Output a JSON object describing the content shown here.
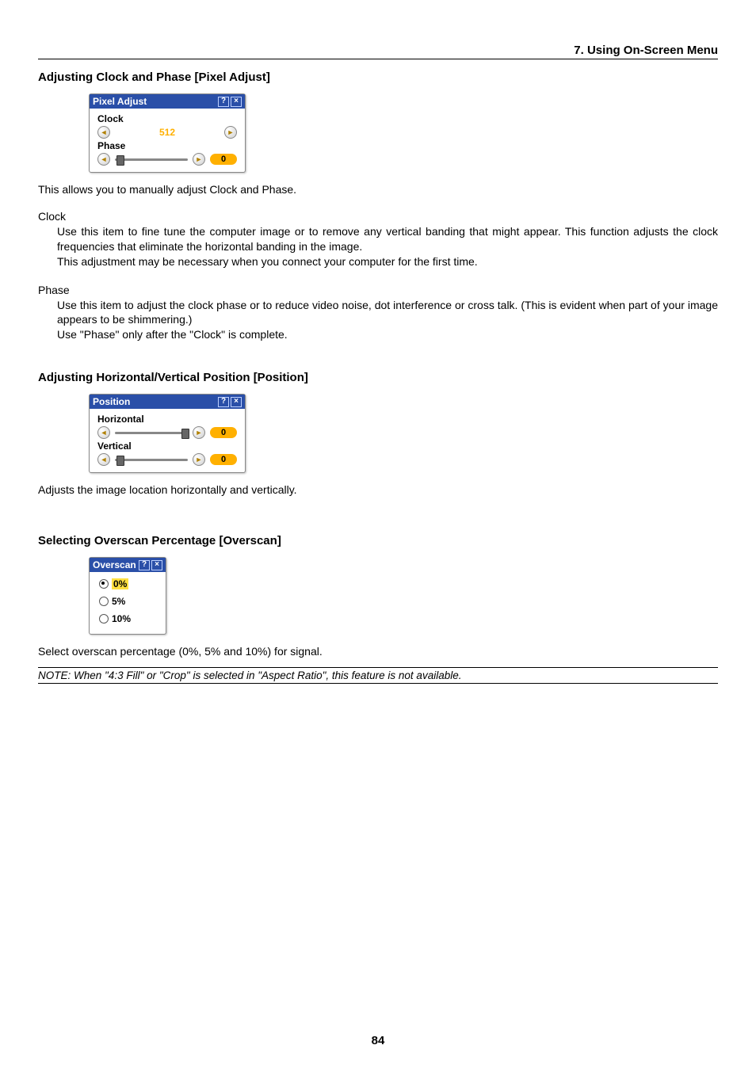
{
  "header": "7. Using On-Screen Menu",
  "page_number": "84",
  "sec1": {
    "title": "Adjusting Clock and Phase [Pixel Adjust]",
    "dialog_title": "Pixel Adjust",
    "clock_label": "Clock",
    "clock_value": "512",
    "phase_label": "Phase",
    "phase_value": "0",
    "intro": "This allows you to manually adjust Clock and Phase.",
    "clock_heading": "Clock",
    "clock_body1": "Use this item to fine tune the computer image or to remove any vertical banding that might appear. This function adjusts the clock frequencies that eliminate the horizontal banding in the image.",
    "clock_body2": "This adjustment may be necessary when you connect your computer for the first time.",
    "phase_heading": "Phase",
    "phase_body1": "Use this item to adjust the clock phase or to reduce video noise, dot interference or cross talk. (This is evident when part of your image appears to be shimmering.)",
    "phase_body2": "Use \"Phase\" only after the \"Clock\" is complete."
  },
  "sec2": {
    "title": "Adjusting Horizontal/Vertical Position [Position]",
    "dialog_title": "Position",
    "h_label": "Horizontal",
    "h_value": "0",
    "v_label": "Vertical",
    "v_value": "0",
    "body": "Adjusts the image location horizontally and vertically."
  },
  "sec3": {
    "title": "Selecting Overscan Percentage [Overscan]",
    "dialog_title": "Overscan",
    "opt0": "0%",
    "opt1": "5%",
    "opt2": "10%",
    "body": "Select overscan percentage (0%, 5% and 10%) for signal.",
    "note": "NOTE: When \"4:3 Fill\" or \"Crop\" is selected in \"Aspect Ratio\", this feature is not available."
  }
}
